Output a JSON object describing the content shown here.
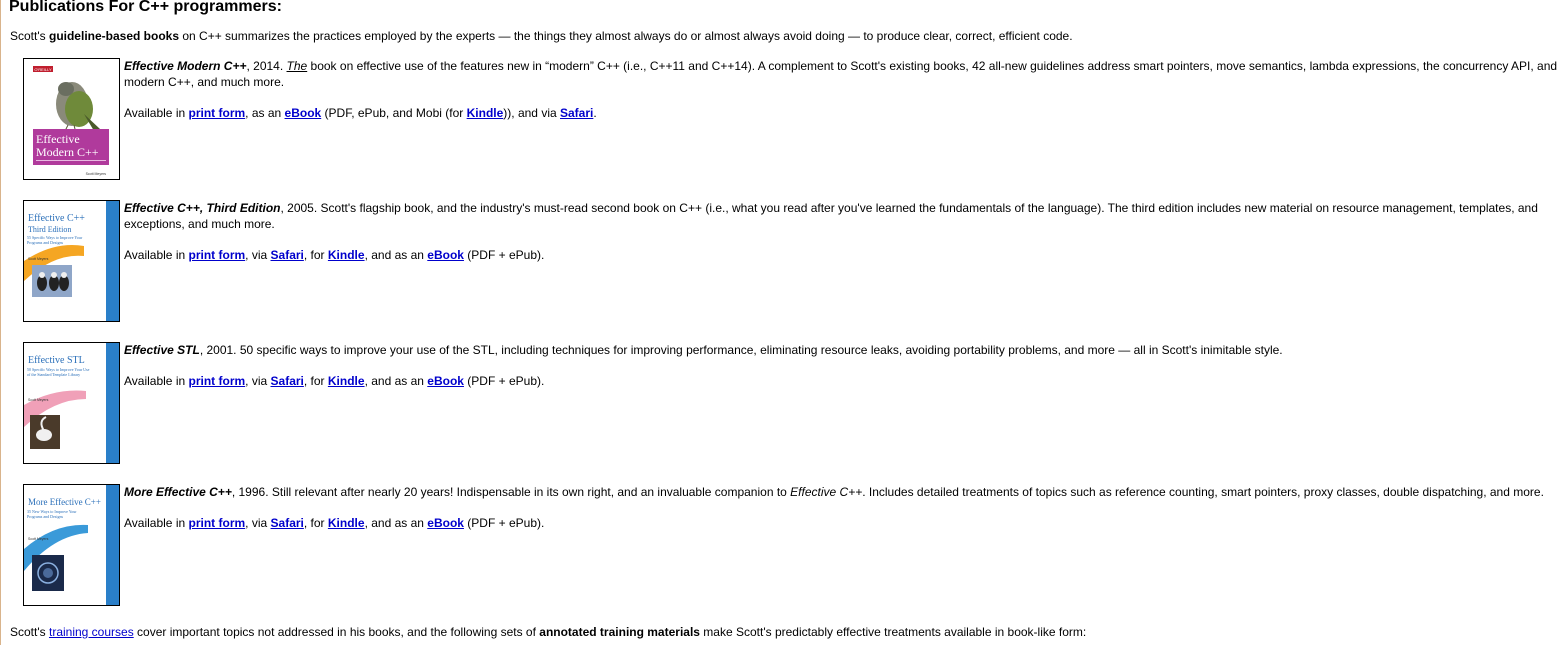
{
  "heading": "Publications For C++ programmers:",
  "intro": {
    "prefix": "Scott's ",
    "bold": "guideline-based books",
    "suffix": " on C++ summarizes the practices employed by the experts — the things they almost always do or almost always avoid doing — to produce clear, correct, efficient code."
  },
  "books": [
    {
      "title": "Effective Modern C++",
      "year_text": ", 2014. ",
      "the": "The",
      "desc": " book on effective use of the features new in “modern” C++ (i.e., C++11 and C++14). A complement to Scott's existing books, 42 all-new guidelines address smart pointers, move semantics, lambda expressions, the concurrency API, and other aspects of",
      "desc2": "modern C++, and much more.",
      "avail": {
        "p1": "Available in ",
        "l1": "print form",
        "p2": ", as an ",
        "l2": "eBook",
        "p3": " (PDF, ePub, and Mobi (for ",
        "l3": "Kindle",
        "p4": ")), and via ",
        "l4": "Safari",
        "p5": "."
      },
      "cover": {
        "publisher": "O'REILLY",
        "line1": "Effective",
        "line2": "Modern C++",
        "author": "Scott Meyers",
        "color": "#b03a9c"
      }
    },
    {
      "title": "Effective C++, Third Edition",
      "year_text": ", 2005. ",
      "desc": "Scott's flagship book, and the industry's must-read second book on C++ (i.e., what you read after you've learned the fundamentals of the language). The third edition includes new material on resource management, templates, and",
      "desc2": "exceptions, and much more.",
      "avail": {
        "p1": "Available in ",
        "l1": "print form",
        "p2": ", via ",
        "l2": "Safari",
        "p3": ", for ",
        "l3": "Kindle",
        "p4": ", and as an ",
        "l4": "eBook",
        "p5": " (PDF + ePub)."
      },
      "cover": {
        "line1": "Effective C++",
        "line2": "Third Edition",
        "sub": "55 Specific Ways to Improve Your Programs and Designs",
        "author": "Scott Meyers",
        "color": "#f5a623"
      }
    },
    {
      "title": "Effective STL",
      "year_text": ", 2001. ",
      "desc": "50 specific ways to improve your use of the STL, including techniques for improving performance, eliminating resource leaks, avoiding portability problems, and more — all in Scott's inimitable style.",
      "desc2": "",
      "avail": {
        "p1": "Available in ",
        "l1": "print form",
        "p2": ", via ",
        "l2": "Safari",
        "p3": ", for ",
        "l3": "Kindle",
        "p4": ", and as an ",
        "l4": "eBook",
        "p5": " (PDF + ePub)."
      },
      "cover": {
        "line1": "Effective STL",
        "sub": "50 Specific Ways to Improve Your Use of the Standard Template Library",
        "author": "Scott Meyers",
        "color": "#f0a0b8"
      }
    },
    {
      "title": "More Effective C++",
      "year_text": ", 1996. ",
      "desc_a": "Still relevant after nearly 20 years! Indispensable in its own right, and an invaluable companion to ",
      "desc_em": "Effective C++",
      "desc_b": ". Includes detailed treatments of topics such as reference counting, smart pointers, proxy classes, double dispatching, and more.",
      "desc2": "",
      "avail": {
        "p1": "Available in ",
        "l1": "print form",
        "p2": ", via ",
        "l2": "Safari",
        "p3": ", for ",
        "l3": "Kindle",
        "p4": ", and as an ",
        "l4": "eBook",
        "p5": " (PDF + ePub)."
      },
      "cover": {
        "line1": "More Effective C++",
        "sub": "35 New Ways to Improve Your Programs and Designs",
        "author": "Scott Meyers",
        "color": "#3a9ad9"
      }
    }
  ],
  "footer": {
    "p1": "Scott's ",
    "link": "training courses",
    "p2": " cover important topics not addressed in his books, and the following sets of ",
    "bold": "annotated training materials",
    "p3": " make Scott's predictably effective treatments available in book-like form:"
  },
  "colors": {
    "link": "#0000cc",
    "left_border": "#d9b48c"
  }
}
